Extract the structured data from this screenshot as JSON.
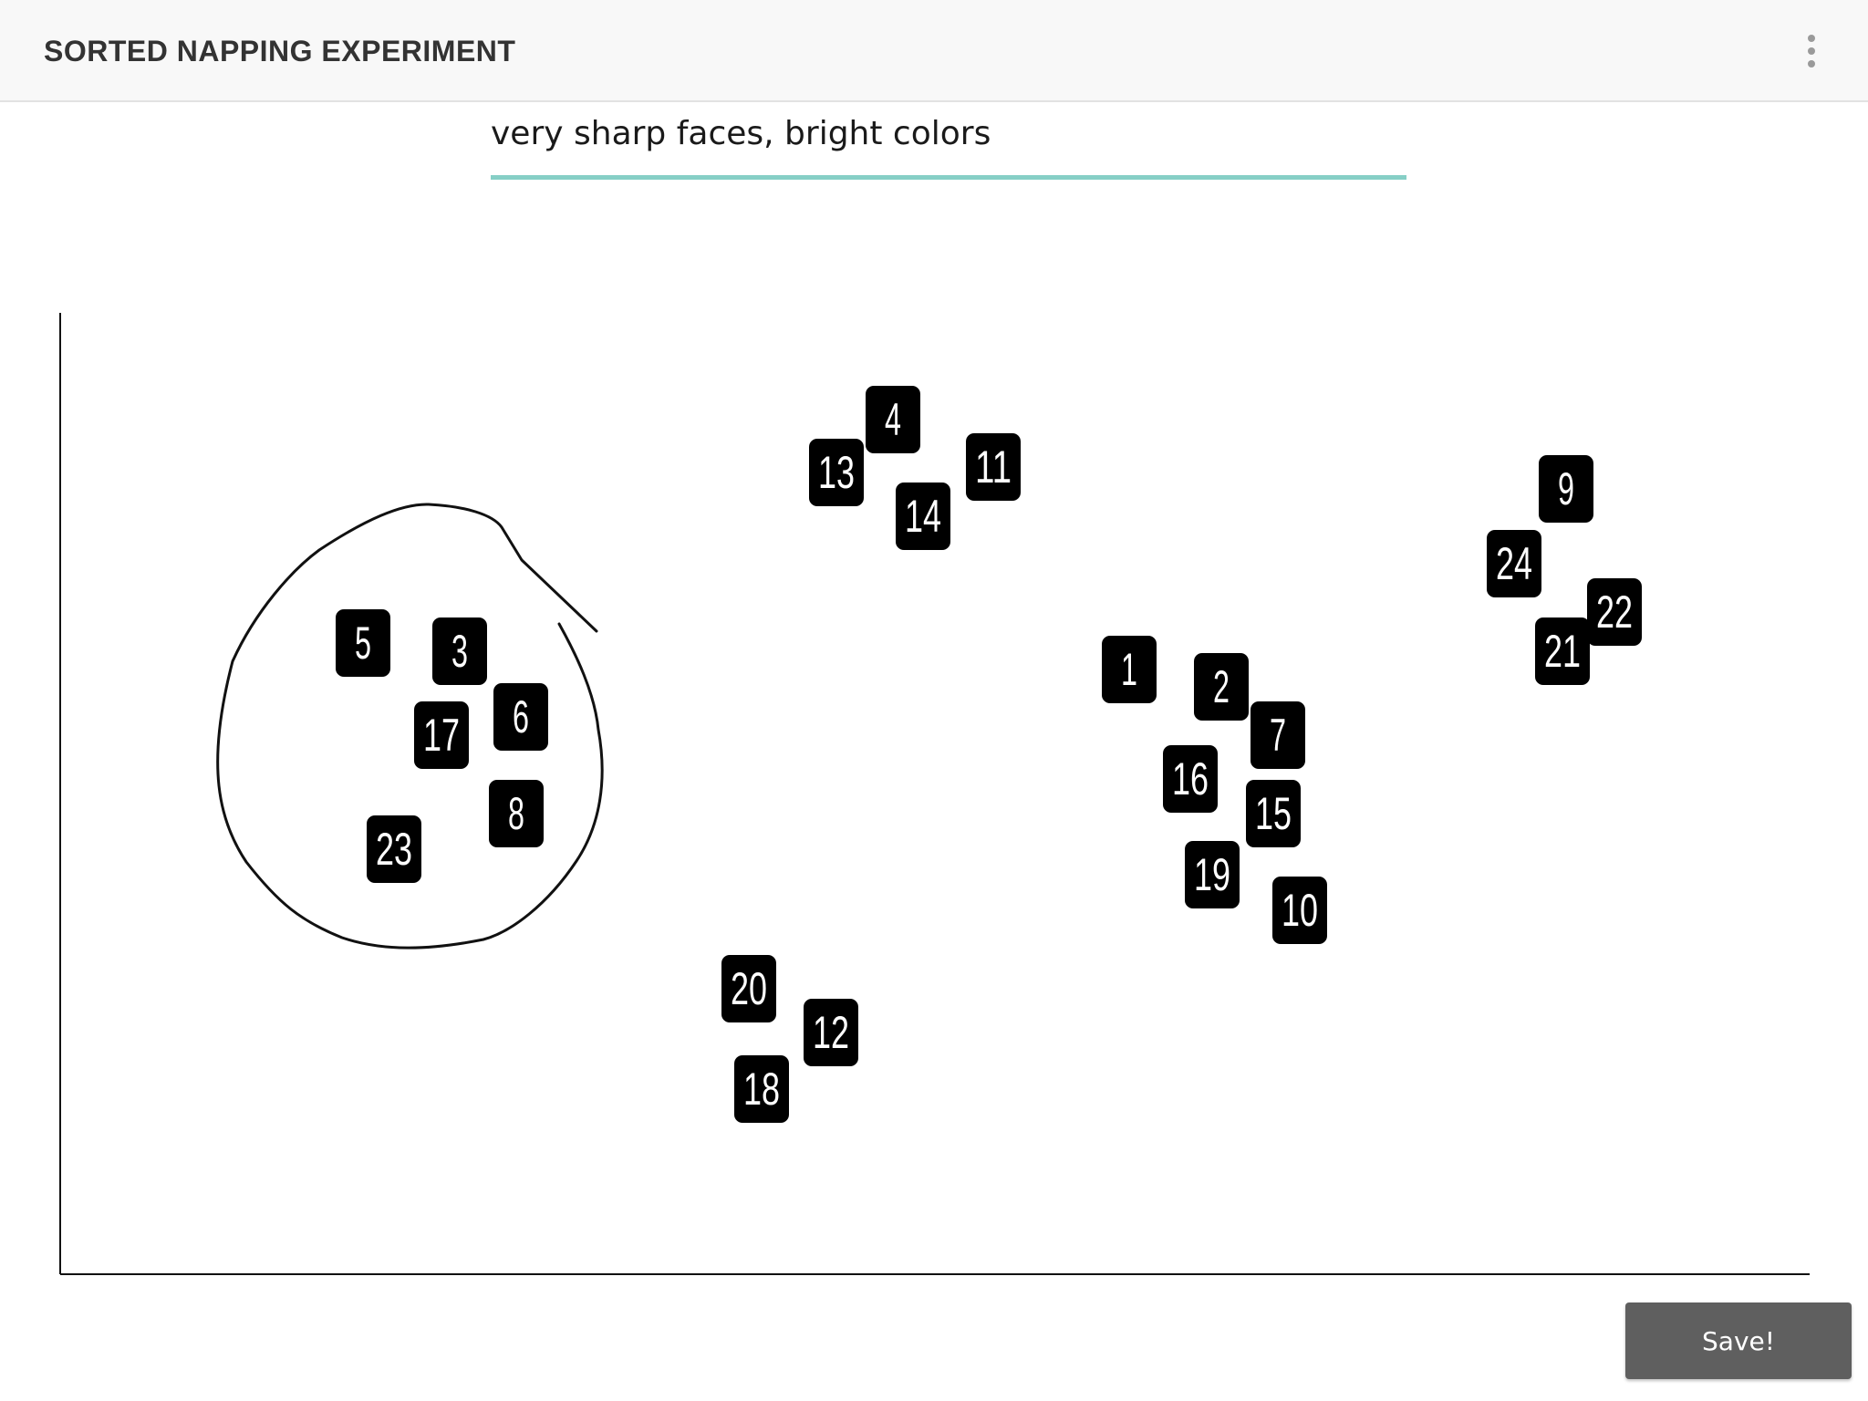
{
  "app_bar": {
    "title": "SORTED NAPPING EXPERIMENT",
    "menu_icon": "more-vert-icon"
  },
  "note": {
    "value": "very sharp faces, bright colors",
    "accent_color": "#86cfc6"
  },
  "board": {
    "tag_color": "#000000",
    "tag_text_color": "#ffffff",
    "tags": [
      {
        "id": "4"
      },
      {
        "id": "13"
      },
      {
        "id": "11"
      },
      {
        "id": "14"
      },
      {
        "id": "9"
      },
      {
        "id": "24"
      },
      {
        "id": "22"
      },
      {
        "id": "21"
      },
      {
        "id": "5"
      },
      {
        "id": "3"
      },
      {
        "id": "17"
      },
      {
        "id": "6"
      },
      {
        "id": "8"
      },
      {
        "id": "23"
      },
      {
        "id": "1"
      },
      {
        "id": "2"
      },
      {
        "id": "7"
      },
      {
        "id": "16"
      },
      {
        "id": "15"
      },
      {
        "id": "19"
      },
      {
        "id": "10"
      },
      {
        "id": "20"
      },
      {
        "id": "12"
      },
      {
        "id": "18"
      }
    ],
    "sketch": "freehand-circle"
  },
  "actions": {
    "save_label": "Save!"
  }
}
